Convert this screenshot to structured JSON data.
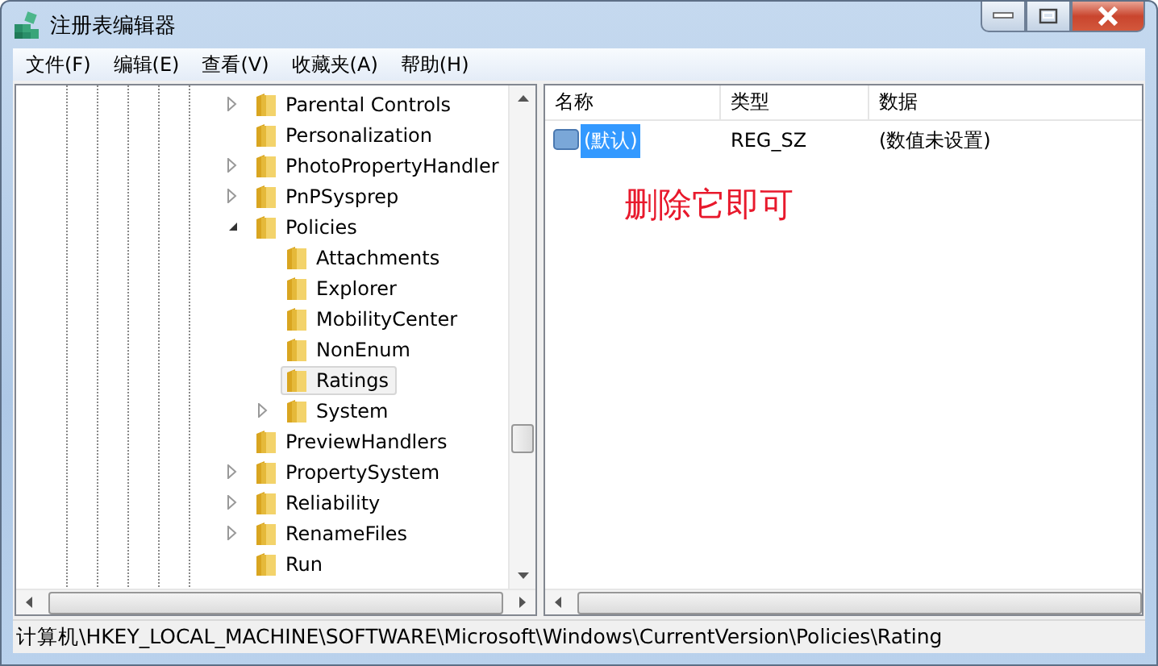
{
  "window": {
    "title": "注册表编辑器"
  },
  "menu": [
    "文件(F)",
    "编辑(E)",
    "查看(V)",
    "收藏夹(A)",
    "帮助(H)"
  ],
  "tree": [
    {
      "label": "Parental Controls",
      "expandable": true,
      "expanded": false,
      "selected": false
    },
    {
      "label": "Personalization",
      "expandable": false,
      "selected": false
    },
    {
      "label": "PhotoPropertyHandler",
      "expandable": true,
      "expanded": false,
      "selected": false
    },
    {
      "label": "PnPSysprep",
      "expandable": true,
      "expanded": false,
      "selected": false
    },
    {
      "label": "Policies",
      "expandable": true,
      "expanded": true,
      "selected": false,
      "children": [
        {
          "label": "Attachments",
          "expandable": false,
          "selected": false
        },
        {
          "label": "Explorer",
          "expandable": false,
          "selected": false
        },
        {
          "label": "MobilityCenter",
          "expandable": false,
          "selected": false
        },
        {
          "label": "NonEnum",
          "expandable": false,
          "selected": false
        },
        {
          "label": "Ratings",
          "expandable": false,
          "selected": true
        },
        {
          "label": "System",
          "expandable": true,
          "expanded": false,
          "selected": false
        }
      ]
    },
    {
      "label": "PreviewHandlers",
      "expandable": false,
      "selected": false
    },
    {
      "label": "PropertySystem",
      "expandable": true,
      "expanded": false,
      "selected": false
    },
    {
      "label": "Reliability",
      "expandable": true,
      "expanded": false,
      "selected": false
    },
    {
      "label": "RenameFiles",
      "expandable": true,
      "expanded": false,
      "selected": false
    },
    {
      "label": "Run",
      "expandable": false,
      "selected": false
    }
  ],
  "list": {
    "columns": [
      "名称",
      "类型",
      "数据"
    ],
    "rows": [
      {
        "cells": [
          "(默认)",
          "REG_SZ",
          "(数值未设置)"
        ],
        "selected": true
      }
    ]
  },
  "annotation": "删除它即可",
  "status_bar": "计算机\\HKEY_LOCAL_MACHINE\\SOFTWARE\\Microsoft\\Windows\\CurrentVersion\\Policies\\Rating"
}
